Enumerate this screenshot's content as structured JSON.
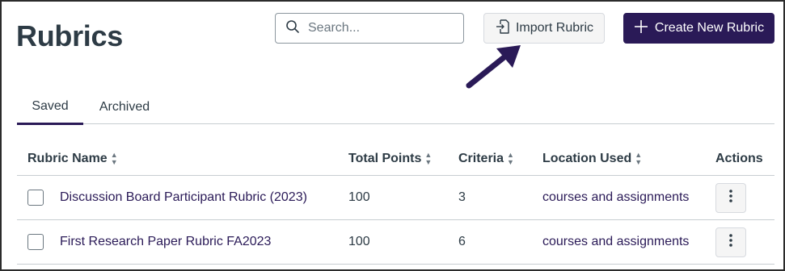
{
  "header": {
    "title": "Rubrics",
    "search_placeholder": "Search...",
    "import_label": "Import Rubric",
    "create_label": "Create New Rubric"
  },
  "tabs": [
    {
      "label": "Saved",
      "selected": true
    },
    {
      "label": "Archived",
      "selected": false
    }
  ],
  "table": {
    "columns": [
      "Rubric Name",
      "Total Points",
      "Criteria",
      "Location Used",
      "Actions"
    ],
    "rows": [
      {
        "name": "Discussion Board Participant Rubric (2023)",
        "points": "100",
        "criteria": "3",
        "location": "courses and assignments"
      },
      {
        "name": "First Research Paper Rubric FA2023",
        "points": "100",
        "criteria": "6",
        "location": "courses and assignments"
      }
    ]
  },
  "icons": {
    "search": "search-icon",
    "import": "import-icon",
    "create": "plus-icon",
    "sort": "sort-icon",
    "actions": "more-vertical-icon",
    "annotation": "annotation-arrow-icon"
  },
  "colors": {
    "primary": "#2a1a57",
    "text": "#2d3b45",
    "border": "#c7cdd1",
    "secondary_button": "#f5f5f5"
  }
}
